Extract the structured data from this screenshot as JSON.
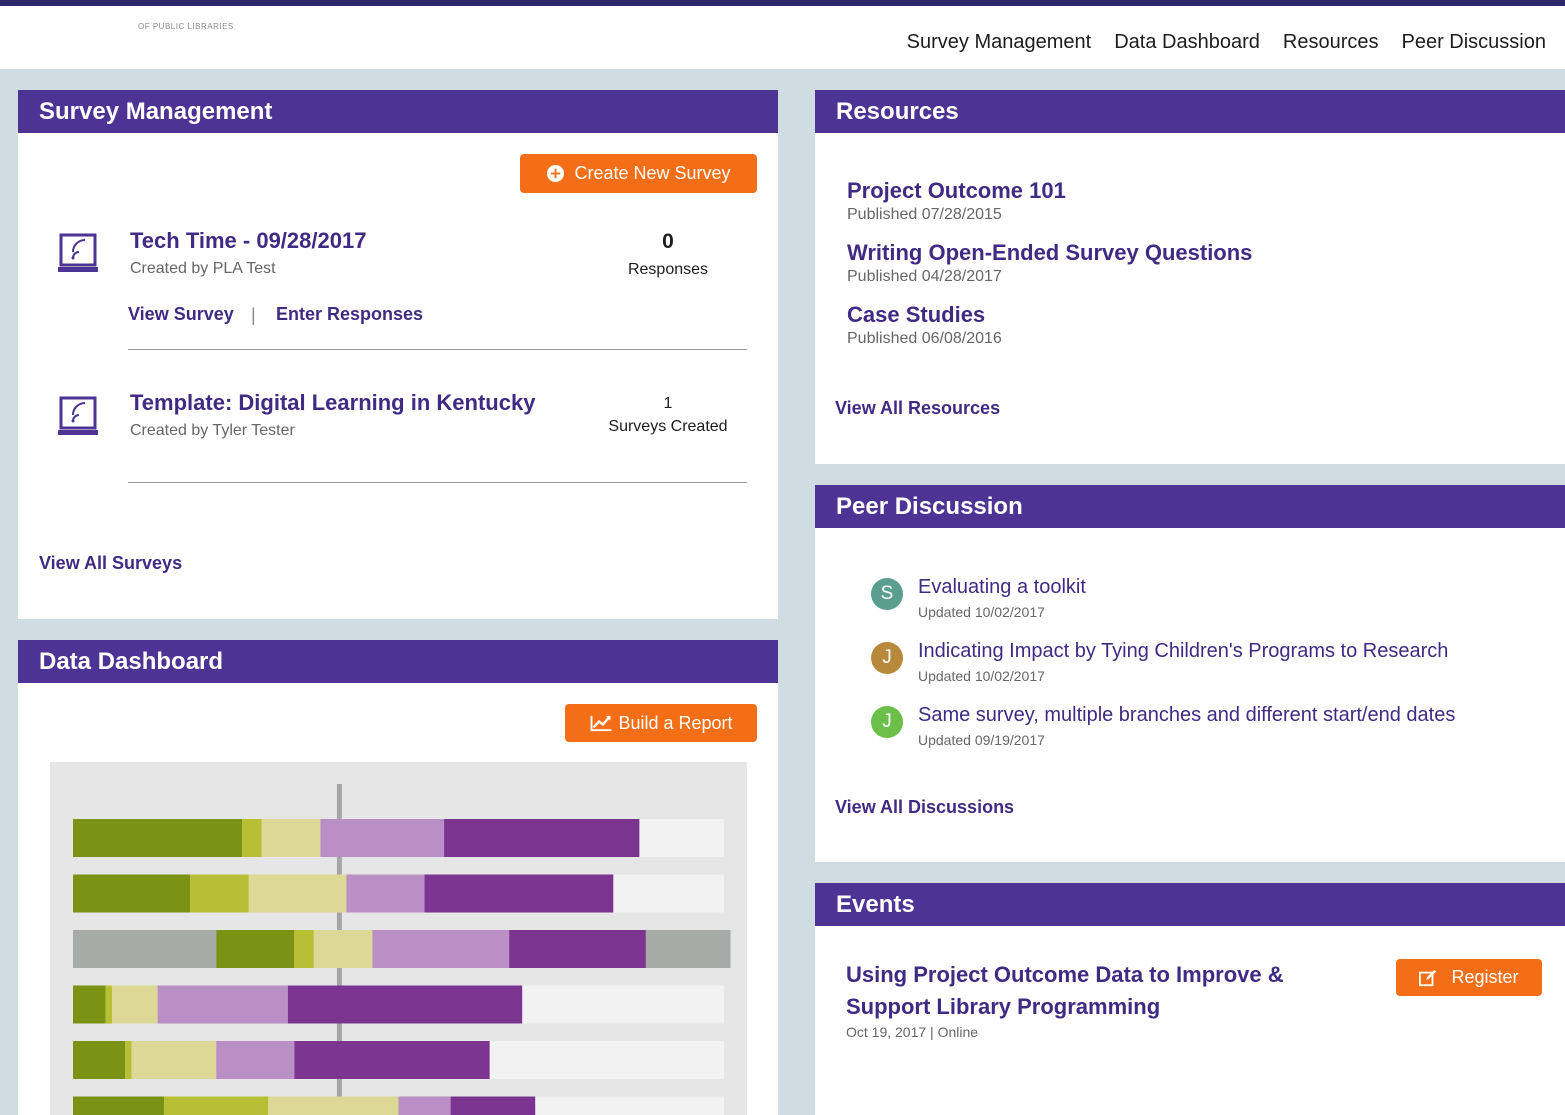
{
  "header": {
    "logo_text": "OF PUBLIC LIBRARIES",
    "nav": [
      "Survey Management",
      "Data Dashboard",
      "Resources",
      "Peer Discussion"
    ]
  },
  "survey_management": {
    "title": "Survey Management",
    "create_button": "Create New Survey",
    "surveys": [
      {
        "title": "Tech Time - 09/28/2017",
        "created_by": "Created by PLA Test",
        "count": "0",
        "count_label": "Responses",
        "links": [
          "View Survey",
          "Enter Responses"
        ],
        "separator": "|"
      },
      {
        "title": "Template: Digital Learning in Kentucky",
        "created_by": "Created by Tyler Tester",
        "count": "1",
        "count_label": "Surveys Created"
      }
    ],
    "view_all": "View All Surveys"
  },
  "data_dashboard": {
    "title": "Data Dashboard",
    "build_button": "Build a Report"
  },
  "chart_data": {
    "type": "bar",
    "stacked": true,
    "rows": [
      [
        0,
        0,
        0.26,
        0.03,
        0.09,
        0.19,
        0.3,
        0
      ],
      [
        0,
        0,
        0.18,
        0.09,
        0.15,
        0.12,
        0.29,
        0
      ],
      [
        0,
        0.22,
        0.12,
        0.03,
        0.09,
        0.21,
        0.21,
        0.13
      ],
      [
        0,
        0,
        0.05,
        0.01,
        0.07,
        0.2,
        0.36,
        0
      ],
      [
        0,
        0,
        0.08,
        0.01,
        0.13,
        0.12,
        0.3,
        0
      ],
      [
        0,
        0,
        0.14,
        0.16,
        0.2,
        0.08,
        0.13,
        0
      ]
    ],
    "colors": [
      "#f2f2f2",
      "#a6aba8",
      "#7b9214",
      "#b7c034",
      "#dcd895",
      "#b98fc6",
      "#7c3491",
      "#a6aba8"
    ],
    "baseline": 0.41
  },
  "resources": {
    "title": "Resources",
    "items": [
      {
        "title": "Project Outcome 101",
        "date": "Published 07/28/2015"
      },
      {
        "title": "Writing Open-Ended Survey Questions",
        "date": "Published 04/28/2017"
      },
      {
        "title": "Case Studies",
        "date": "Published 06/08/2016"
      }
    ],
    "view_all": "View All Resources"
  },
  "peer_discussion": {
    "title": "Peer Discussion",
    "items": [
      {
        "initial": "S",
        "color": "#5a9e8f",
        "title": "Evaluating a toolkit",
        "date": "Updated 10/02/2017"
      },
      {
        "initial": "J",
        "color": "#b8893a",
        "title": "Indicating Impact by Tying Children's Programs to Research",
        "date": "Updated 10/02/2017"
      },
      {
        "initial": "J",
        "color": "#6cc04a",
        "title": "Same survey, multiple branches and different start/end dates",
        "date": "Updated 09/19/2017"
      }
    ],
    "view_all": "View All Discussions"
  },
  "events": {
    "title": "Events",
    "items": [
      {
        "title_line1": "Using Project Outcome Data to Improve &",
        "title_line2": "Support Library Programming",
        "meta": "Oct 19, 2017 | Online",
        "register": "Register"
      }
    ]
  },
  "colors": {
    "purple": "#4d3393",
    "orange": "#f36e16",
    "link": "#4a3490"
  },
  "icons": [
    "plus-circle-icon",
    "chart-line-icon",
    "edit-icon",
    "survey-screen-icon"
  ]
}
